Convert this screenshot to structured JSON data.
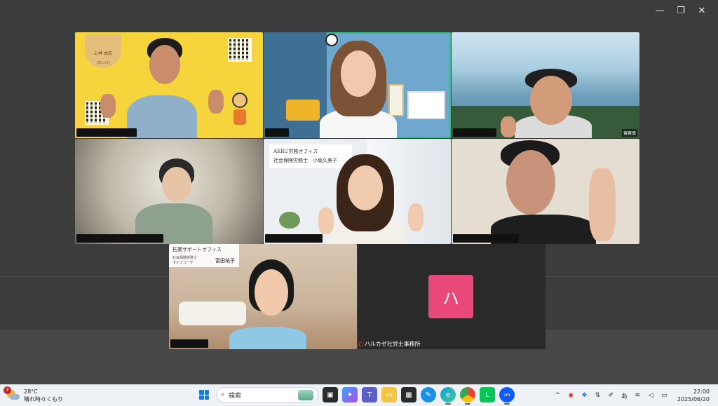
{
  "window_controls": {
    "minimize": "—",
    "restore": "❐",
    "close": "✕"
  },
  "tiles": {
    "t1": {
      "badge_title": "上林 由宏",
      "badge_sub": "(カンバ)"
    },
    "t3": {
      "name_label": "齋藤慎"
    },
    "t5": {
      "sign_line1": "AERU労務オフィス",
      "sign_line2": "社会保険労務士　小坂久美子"
    },
    "t7": {
      "sign_line1": "拓業サポートオフィス",
      "sign_line2": "社会保険労務士",
      "sign_line3": "ライフコーチ",
      "sign_name": "富田祐子"
    },
    "t8": {
      "avatar_letter": "ハ",
      "name": "ハルカゼ社労士事務所"
    }
  },
  "taskbar": {
    "weather": {
      "badge": "7",
      "temp": "28°C",
      "condition": "晴れ時々くもり"
    },
    "search_placeholder": "検索",
    "tray": {
      "chevron": "^",
      "ime": "あ"
    },
    "clock": {
      "time": "22:00",
      "date": "2025/06/20"
    }
  }
}
